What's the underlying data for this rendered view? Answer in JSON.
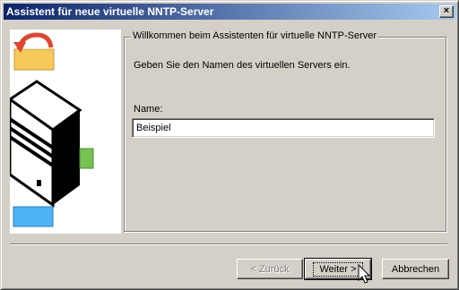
{
  "window": {
    "title": "Assistent für neue virtuelle NNTP-Server",
    "close_glyph": "×"
  },
  "group": {
    "legend": "Willkommen beim Assistenten für virtuelle NNTP-Server",
    "instruction": "Geben Sie den Namen des virtuellen Servers ein.",
    "name_label": "Name:",
    "name_value": "Beispiel"
  },
  "buttons": {
    "back": "< Zurück",
    "next": "Weiter >",
    "cancel": "Abbrechen"
  },
  "illustration": {
    "icons": [
      "undo-arrow-folder-icon",
      "server-tower-icon",
      "green-block-icon",
      "blue-block-icon"
    ],
    "colors": {
      "folder": "#f7c85a",
      "arrow": "#e0442c",
      "green": "#76c252",
      "blue": "#4db3f5"
    }
  }
}
